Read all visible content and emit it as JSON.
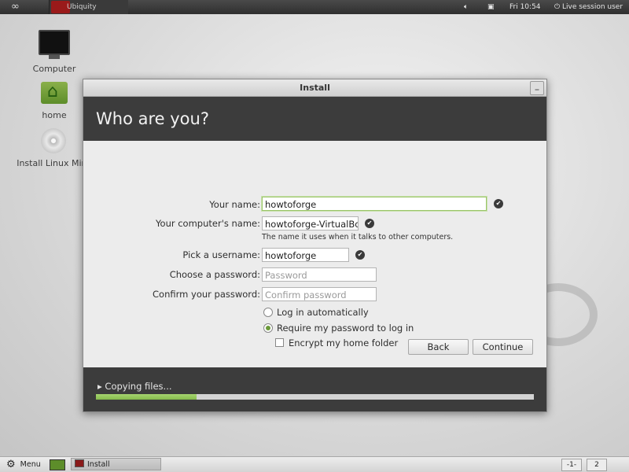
{
  "top_panel": {
    "infinity_icon": "∞",
    "task_label": "Ubiquity",
    "clock": "Fri 10:54",
    "session_user": "Live session user"
  },
  "desktop": {
    "icons": [
      {
        "label": "Computer"
      },
      {
        "label": "home"
      },
      {
        "label": "Install Linux Mint"
      }
    ]
  },
  "window": {
    "title": "Install",
    "minimize_symbol": "_",
    "heading": "Who are you?"
  },
  "form": {
    "name_label": "Your name:",
    "name_value": "howtoforge",
    "computer_label": "Your computer's name:",
    "computer_value": "howtoforge-VirtualBox",
    "computer_hint": "The name it uses when it talks to other computers.",
    "username_label": "Pick a username:",
    "username_value": "howtoforge",
    "password_label": "Choose a password:",
    "password_placeholder": "Password",
    "confirm_label": "Confirm your password:",
    "confirm_placeholder": "Confirm password",
    "login_auto": "Log in automatically",
    "login_password": "Require my password to log in",
    "encrypt_home": "Encrypt my home folder",
    "selected_login": "password",
    "encrypt_checked": false,
    "check_symbol": "✔"
  },
  "buttons": {
    "back": "Back",
    "continue": "Continue"
  },
  "progress": {
    "label": "▸ Copying files...",
    "fraction": 0.23
  },
  "bottom_panel": {
    "menu_label": "Menu",
    "gear_symbol": "⚙",
    "task_label": "Install",
    "workspace_1": "-1-",
    "workspace_2": "2"
  }
}
